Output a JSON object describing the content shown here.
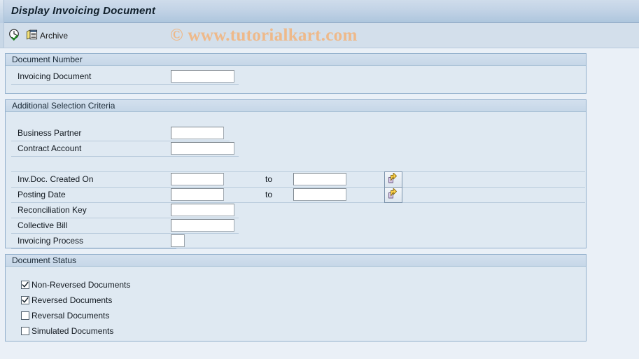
{
  "window": {
    "title": "Display Invoicing Document"
  },
  "toolbar": {
    "execute_icon": "clock-check-icon",
    "execute_label": "",
    "archive_icon": "archive-icon",
    "archive_label": "Archive"
  },
  "watermark": {
    "text": "© www.tutorialkart.com",
    "color": "#eeb98a"
  },
  "sections": {
    "document_number": {
      "header": "Document Number",
      "fields": [
        {
          "label": "Invoicing Document",
          "value": "",
          "placeholder": ""
        }
      ]
    },
    "additional_selection_criteria": {
      "header": "Additional Selection Criteria",
      "fields": [
        {
          "label": "Business Partner",
          "value": "",
          "placeholder": ""
        },
        {
          "label": "Contract Account",
          "value": "",
          "placeholder": ""
        }
      ],
      "range_fields": [
        {
          "label": "Inv.Doc. Created On",
          "from_value": "",
          "to_label": "to",
          "to_value": "",
          "multi_icon": "multiple-selection-arrow-icon"
        },
        {
          "label": "Posting Date",
          "from_value": "",
          "to_label": "to",
          "to_value": "",
          "multi_icon": "multiple-selection-arrow-icon"
        }
      ],
      "fields2": [
        {
          "label": "Reconciliation Key",
          "value": "",
          "placeholder": ""
        },
        {
          "label": "Collective Bill",
          "value": "",
          "placeholder": ""
        },
        {
          "label": "Invoicing Process",
          "value": "",
          "placeholder": ""
        }
      ]
    },
    "document_status": {
      "header": "Document Status",
      "checkboxes": [
        {
          "label": "Non-Reversed Documents",
          "checked": true
        },
        {
          "label": "Reversed Documents",
          "checked": true
        },
        {
          "label": "Reversal Documents",
          "checked": false
        },
        {
          "label": "Simulated Documents",
          "checked": false
        }
      ]
    }
  },
  "colors": {
    "title_bar_bg": "#c2d3e6",
    "panel_bg": "#dfe9f2",
    "panel_border": "#93b0cc",
    "page_bg": "#eaf0f7",
    "accent_arrow": "#ffd24a"
  }
}
